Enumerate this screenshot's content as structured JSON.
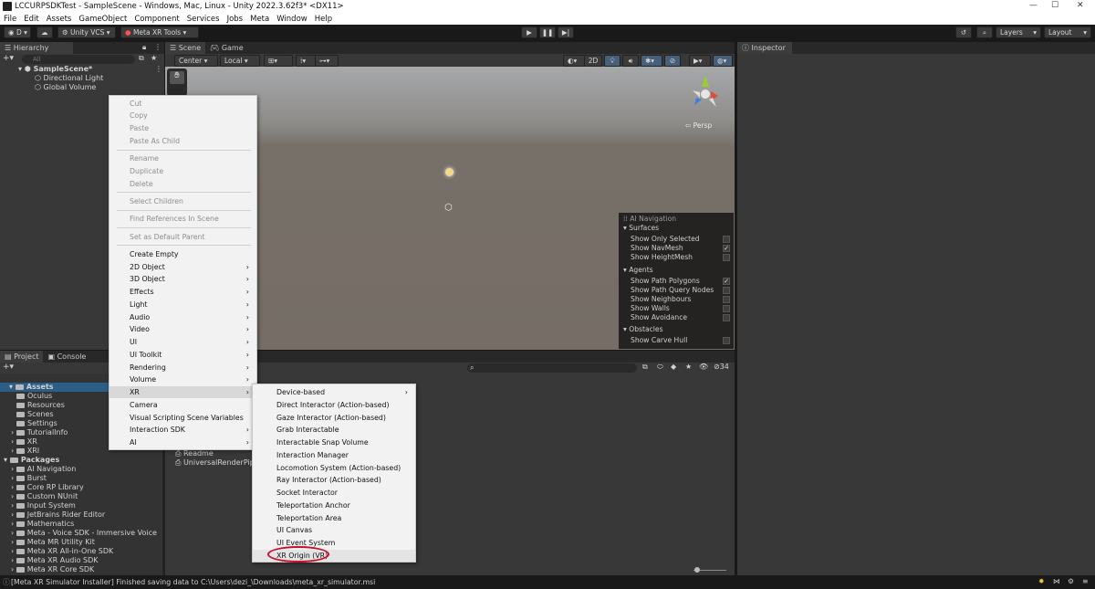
{
  "window": {
    "title": "LCCURPSDKTest - SampleScene - Windows, Mac, Linux - Unity 2022.3.62f3* <DX11>",
    "min": "—",
    "max": "☐",
    "close": "✕"
  },
  "menu": [
    "File",
    "Edit",
    "Assets",
    "GameObject",
    "Component",
    "Services",
    "Jobs",
    "Meta",
    "Window",
    "Help"
  ],
  "toolbar": {
    "account": "D",
    "vcs": "Unity VCS",
    "meta": "Meta XR Tools",
    "layers": "Layers",
    "layout": "Layout"
  },
  "hierarchy": {
    "tab": "Hierarchy",
    "search_placeholder": "All",
    "scene": "SampleScene*",
    "items": [
      "Directional Light",
      "Global Volume"
    ]
  },
  "scene": {
    "tab_scene": "Scene",
    "tab_game": "Game",
    "pivot": "Center",
    "space": "Local",
    "mode2d": "2D",
    "persp": "Persp"
  },
  "inspector": {
    "tab": "Inspector"
  },
  "nav_overlay": {
    "title": "AI Navigation",
    "sections": [
      {
        "name": "Surfaces",
        "items": [
          {
            "label": "Show Only Selected",
            "checked": false
          },
          {
            "label": "Show NavMesh",
            "checked": true
          },
          {
            "label": "Show HeightMesh",
            "checked": false
          }
        ]
      },
      {
        "name": "Agents",
        "items": [
          {
            "label": "Show Path Polygons",
            "checked": true
          },
          {
            "label": "Show Path Query Nodes",
            "checked": false
          },
          {
            "label": "Show Neighbours",
            "checked": false
          },
          {
            "label": "Show Walls",
            "checked": false
          },
          {
            "label": "Show Avoidance",
            "checked": false
          }
        ]
      },
      {
        "name": "Obstacles",
        "items": [
          {
            "label": "Show Carve Hull",
            "checked": false
          }
        ]
      }
    ]
  },
  "project": {
    "tab_project": "Project",
    "tab_console": "Console",
    "count": "34",
    "assets_label": "Assets",
    "assets": [
      "Oculus",
      "Resources",
      "Scenes",
      "Settings",
      "TutorialInfo",
      "XR",
      "XRI"
    ],
    "packages_label": "Packages",
    "packages": [
      "AI Navigation",
      "Burst",
      "Core RP Library",
      "Custom NUnit",
      "Input System",
      "JetBrains Rider Editor",
      "Mathematics",
      "Meta - Voice SDK - Immersive Voice Cor",
      "Meta MR Utility Kit",
      "Meta XR All-in-One SDK",
      "Meta XR Audio SDK",
      "Meta XR Core SDK"
    ],
    "files": [
      "Readme",
      "UniversalRenderPipel"
    ]
  },
  "context_menu": {
    "disabled1": [
      "Cut",
      "Copy",
      "Paste",
      "Paste As Child"
    ],
    "disabled2": [
      "Rename",
      "Duplicate",
      "Delete"
    ],
    "disabled3": [
      "Select Children"
    ],
    "disabled4": [
      "Find References In Scene"
    ],
    "disabled5": [
      "Set as Default Parent"
    ],
    "items": [
      {
        "label": "Create Empty",
        "sub": false
      },
      {
        "label": "2D Object",
        "sub": true
      },
      {
        "label": "3D Object",
        "sub": true
      },
      {
        "label": "Effects",
        "sub": true
      },
      {
        "label": "Light",
        "sub": true
      },
      {
        "label": "Audio",
        "sub": true
      },
      {
        "label": "Video",
        "sub": true
      },
      {
        "label": "UI",
        "sub": true
      },
      {
        "label": "UI Toolkit",
        "sub": true
      },
      {
        "label": "Rendering",
        "sub": true
      },
      {
        "label": "Volume",
        "sub": true
      },
      {
        "label": "XR",
        "sub": true
      },
      {
        "label": "Camera",
        "sub": false
      },
      {
        "label": "Visual Scripting Scene Variables",
        "sub": false
      },
      {
        "label": "Interaction SDK",
        "sub": true
      },
      {
        "label": "AI",
        "sub": true
      }
    ]
  },
  "xr_submenu": [
    "Device-based",
    "Direct Interactor (Action-based)",
    "Gaze Interactor (Action-based)",
    "Grab Interactable",
    "Interactable Snap Volume",
    "Interaction Manager",
    "Locomotion System (Action-based)",
    "Ray Interactor (Action-based)",
    "Socket Interactor",
    "Teleportation Anchor",
    "Teleportation Area",
    "UI Canvas",
    "UI Event System",
    "XR Origin (VR)"
  ],
  "status": {
    "message": "[Meta XR Simulator Installer] Finished saving data to C:\\Users\\dezi_\\Downloads\\meta_xr_simulator.msi"
  },
  "colors": {
    "highlight_circle": "#c8102e",
    "unity_dark": "#383838"
  }
}
